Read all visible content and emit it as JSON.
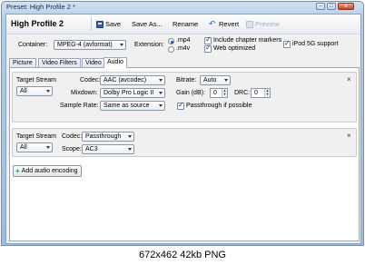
{
  "window": {
    "title": "Preset: High Profile 2 *",
    "controls": {
      "minimize": "–",
      "maximize": "□",
      "close": "x"
    }
  },
  "toolbar": {
    "profile_name": "High Profile 2",
    "save_label": "Save",
    "save_as_label": "Save As...",
    "rename_label": "Rename",
    "revert_label": "Revert",
    "preview_label": "Preview"
  },
  "container": {
    "label": "Container:",
    "value": "MPEG-4 (avformat)",
    "extension_label": "Extension:",
    "extension_options": [
      {
        "label": ".mp4",
        "selected": true
      },
      {
        "label": ".m4v",
        "selected": false
      }
    ],
    "include_chapter_markers": {
      "label": "Include chapter markers",
      "checked": true
    },
    "web_optimized": {
      "label": "Web optimized",
      "checked": true
    },
    "ipod_5g_support": {
      "label": "iPod 5G support",
      "checked": true
    }
  },
  "tabs": [
    {
      "label": "Picture",
      "active": false
    },
    {
      "label": "Video Filters",
      "active": false
    },
    {
      "label": "Video",
      "active": false
    },
    {
      "label": "Audio",
      "active": true
    }
  ],
  "audio_tracks": [
    {
      "target_stream_label": "Target Stream",
      "target_stream": "All",
      "codec_label": "Codec:",
      "codec": "AAC (avcodec)",
      "mixdown_label": "Mixdown:",
      "mixdown": "Dolby Pro Logic II",
      "sample_rate_label": "Sample Rate:",
      "sample_rate": "Same as source",
      "bitrate_label": "Bitrate:",
      "bitrate": "Auto",
      "gain_label": "Gain (dB):",
      "gain": "0",
      "drc_label": "DRC:",
      "drc": "0",
      "passthrough_label": "Passthrough if possible",
      "passthrough_checked": true,
      "remove_icon": "close-icon"
    },
    {
      "target_stream_label": "Target Stream",
      "target_stream": "All",
      "codec_label": "Codec:",
      "codec": "Passthrough",
      "scope_label": "Scope:",
      "scope": "AC3",
      "remove_icon": "close-icon"
    }
  ],
  "add_audio_label": "Add audio encoding",
  "caption": "672x462 42kb PNG"
}
